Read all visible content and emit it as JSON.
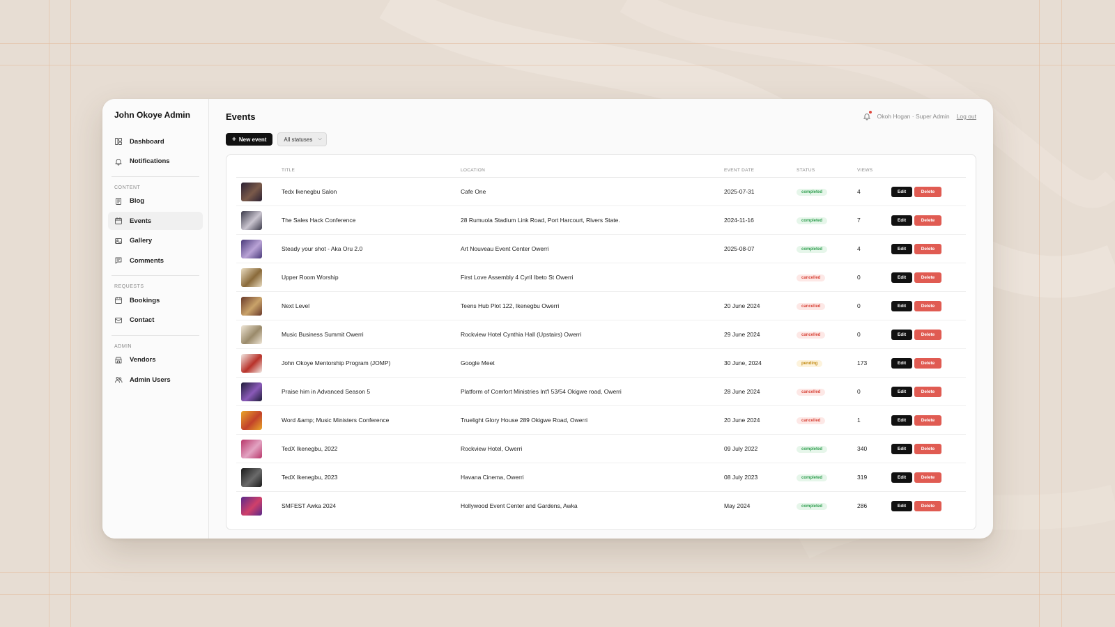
{
  "sidebar": {
    "app_title": "John Okoye Admin",
    "top_items": [
      {
        "label": "Dashboard",
        "icon": "dashboard-icon"
      },
      {
        "label": "Notifications",
        "icon": "bell-icon"
      }
    ],
    "sections": [
      {
        "label": "CONTENT",
        "items": [
          {
            "label": "Blog",
            "icon": "document-icon"
          },
          {
            "label": "Events",
            "icon": "calendar-icon",
            "active": true
          },
          {
            "label": "Gallery",
            "icon": "image-icon"
          },
          {
            "label": "Comments",
            "icon": "comment-icon"
          }
        ]
      },
      {
        "label": "REQUESTS",
        "items": [
          {
            "label": "Bookings",
            "icon": "calendar-icon"
          },
          {
            "label": "Contact",
            "icon": "mail-icon"
          }
        ]
      },
      {
        "label": "ADMIN",
        "items": [
          {
            "label": "Vendors",
            "icon": "store-icon"
          },
          {
            "label": "Admin Users",
            "icon": "users-icon"
          }
        ]
      }
    ]
  },
  "header": {
    "title": "Events",
    "user_label": "Okoh Hogan · Super Admin",
    "logout_label": "Log out"
  },
  "toolbar": {
    "new_button_label": "New event",
    "status_filter": "All statuses"
  },
  "table": {
    "columns": [
      "",
      "TITLE",
      "LOCATION",
      "EVENT DATE",
      "STATUS",
      "VIEWS",
      ""
    ],
    "edit_label": "Edit",
    "delete_label": "Delete",
    "rows": [
      {
        "title": "Tedx Ikenegbu Salon",
        "location": "Cafe One",
        "date": "2025-07-31",
        "status": "completed",
        "views": "4",
        "thumb_colors": [
          "#2b2133",
          "#7a5a4a"
        ]
      },
      {
        "title": "The Sales Hack Conference",
        "location": "28 Rumuola Stadium Link Road, Port Harcourt, Rivers State.",
        "date": "2024-11-16",
        "status": "completed",
        "views": "7",
        "thumb_colors": [
          "#3b3a4a",
          "#c9c4cf"
        ]
      },
      {
        "title": "Steady your shot - Aka Oru 2.0",
        "location": "Art Nouveau Event Center Owerri",
        "date": "2025-08-07",
        "status": "completed",
        "views": "4",
        "thumb_colors": [
          "#4a3a7a",
          "#b9a3d6"
        ]
      },
      {
        "title": "Upper Room Worship",
        "location": "First Love Assembly 4 Cyril Ibeto St Owerri",
        "date": "",
        "status": "cancelled",
        "views": "0",
        "thumb_colors": [
          "#e9dcc1",
          "#8a6a3a"
        ]
      },
      {
        "title": "Next Level",
        "location": "Teens Hub Plot 122, Ikenegbu Owerri",
        "date": "20 June 2024",
        "status": "cancelled",
        "views": "0",
        "thumb_colors": [
          "#6a3a2a",
          "#c9a36a"
        ]
      },
      {
        "title": "Music Business Summit Owerri",
        "location": "Rockview Hotel Cynthia Hall (Upstairs) Owerri",
        "date": "29 June 2024",
        "status": "cancelled",
        "views": "0",
        "thumb_colors": [
          "#efe6d6",
          "#9a8a6a"
        ]
      },
      {
        "title": "John Okoye Mentorship Program (JOMP)",
        "location": "Google Meet",
        "date": "30 June, 2024",
        "status": "pending",
        "views": "173",
        "thumb_colors": [
          "#f2e9e4",
          "#b8322a"
        ]
      },
      {
        "title": "Praise him in Advanced Season 5",
        "location": "Platform of Comfort Ministries Int'l 53/54 Okigwe road, Owerri",
        "date": "28 June 2024",
        "status": "cancelled",
        "views": "0",
        "thumb_colors": [
          "#1f1c3a",
          "#8a5ab8"
        ]
      },
      {
        "title": "Word &amp; Music Ministers Conference",
        "location": "Truelight Glory House 289 Okigwe Road, Owerri",
        "date": "20 June 2024",
        "status": "cancelled",
        "views": "1",
        "thumb_colors": [
          "#e9a52a",
          "#c2422a"
        ]
      },
      {
        "title": "TedX Ikenegbu, 2022",
        "location": "Rockview Hotel, Owerri",
        "date": "09 July 2022",
        "status": "completed",
        "views": "340",
        "thumb_colors": [
          "#b8376a",
          "#e2a3c2"
        ]
      },
      {
        "title": "TedX Ikenegbu, 2023",
        "location": "Havana Cinema, Owerri",
        "date": "08 July 2023",
        "status": "completed",
        "views": "319",
        "thumb_colors": [
          "#1a1a1a",
          "#6a6a6a"
        ]
      },
      {
        "title": "SMFEST Awka 2024",
        "location": "Hollywood Event Center and Gardens, Awka",
        "date": "May 2024",
        "status": "completed",
        "views": "286",
        "thumb_colors": [
          "#5a2a8a",
          "#d0406a"
        ]
      }
    ]
  }
}
